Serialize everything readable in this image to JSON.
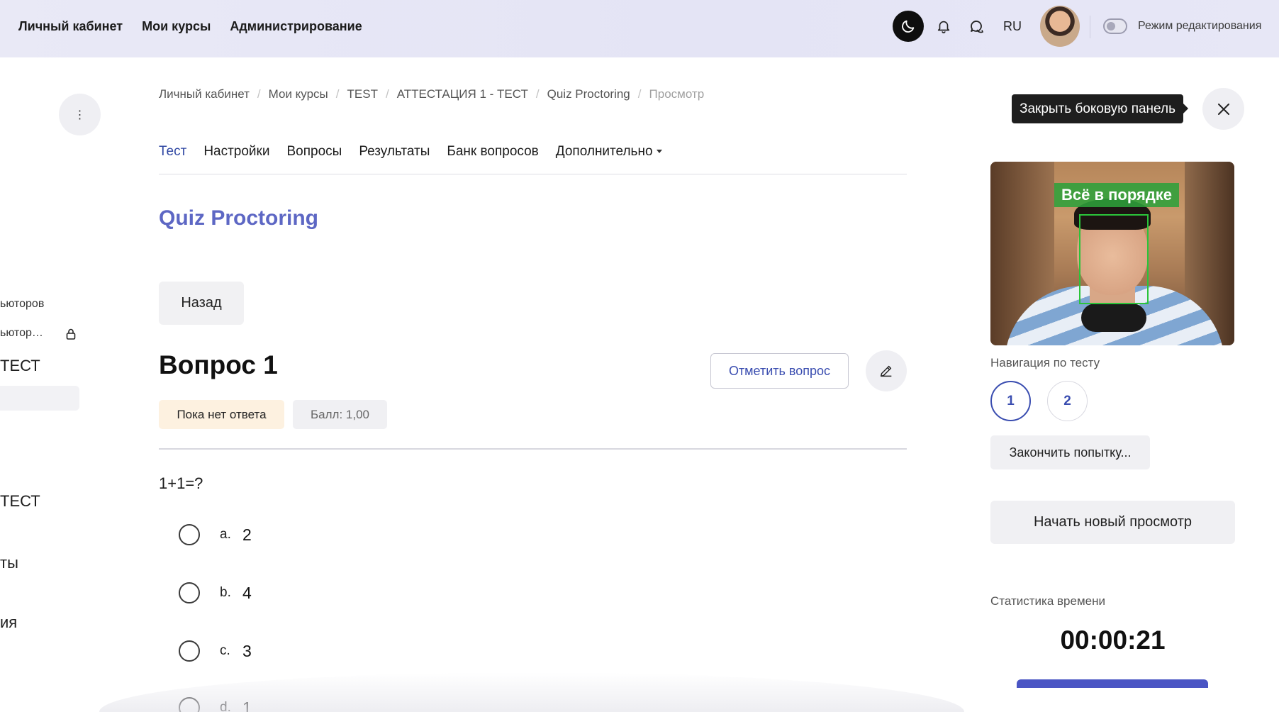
{
  "header": {
    "nav": [
      "Личный кабинет",
      "Мои курсы",
      "Администрирование"
    ],
    "lang": "RU",
    "edit_mode_label": "Режим редактирования",
    "icons": [
      "moon-icon",
      "bell-icon",
      "chat-icon",
      "avatar"
    ]
  },
  "sidebar": {
    "items": [
      {
        "label": "ьюторов"
      },
      {
        "label": "ьютор…"
      },
      {
        "label": "ТЕСТ"
      },
      {
        "label": "ТЕСТ"
      },
      {
        "label": "ты"
      },
      {
        "label": "ия"
      }
    ]
  },
  "breadcrumb": [
    "Личный кабинет",
    "Мои курсы",
    "TEST",
    "АТТЕСТАЦИЯ 1 - ТЕСТ",
    "Quiz Proctoring",
    "Просмотр"
  ],
  "tabs": [
    "Тест",
    "Настройки",
    "Вопросы",
    "Результаты",
    "Банк вопросов",
    "Дополнительно"
  ],
  "quiz_title": "Quiz Proctoring",
  "back_label": "Назад",
  "question": {
    "title": "Вопрос 1",
    "flag_label": "Отметить вопрос",
    "status": "Пока нет ответа",
    "score": "Балл: 1,00",
    "text": "1+1=?",
    "answers": [
      {
        "letter": "a.",
        "text": "2"
      },
      {
        "letter": "b.",
        "text": "4"
      },
      {
        "letter": "c.",
        "text": "3"
      },
      {
        "letter": "d.",
        "text": "1"
      }
    ]
  },
  "panel": {
    "tooltip": "Закрыть боковую панель",
    "webcam_status": "Всё в порядке",
    "nav_label": "Навигация по тесту",
    "nav_buttons": [
      "1",
      "2"
    ],
    "finish_label": "Закончить попытку...",
    "preview_label": "Начать новый просмотр",
    "time_label": "Статистика времени",
    "timer": "00:00:21"
  },
  "colors": {
    "accent": "#3a4db0",
    "title": "#5d67c4",
    "face_box": "#2bc43a"
  }
}
